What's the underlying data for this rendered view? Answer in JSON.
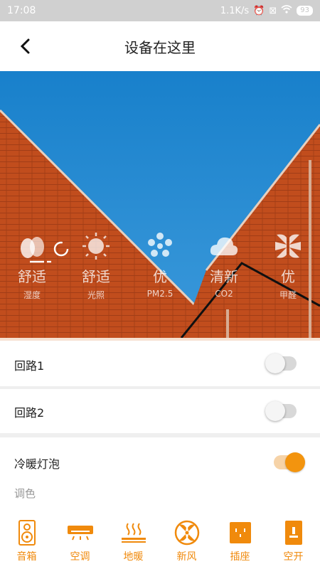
{
  "status_bar": {
    "time": "17:08",
    "speed": "1.1K/s",
    "battery": "93"
  },
  "header": {
    "title": "设备在这里"
  },
  "sensors": [
    {
      "value": "舒适",
      "label": "湿度",
      "icon": "egg-drops-icon"
    },
    {
      "value": "舒适",
      "label": "光照",
      "icon": "sun-icon"
    },
    {
      "value": "优",
      "label": "PM2.5",
      "icon": "particles-icon"
    },
    {
      "value": "清新",
      "label": "CO2",
      "icon": "cloud-icon"
    },
    {
      "value": "优",
      "label": "甲醛",
      "icon": "petals-icon"
    }
  ],
  "switches": [
    {
      "label": "回路1",
      "state": "off"
    },
    {
      "label": "回路2",
      "state": "off"
    },
    {
      "label": "冷暖灯泡",
      "state": "on",
      "sub": "调色"
    }
  ],
  "tabs": [
    {
      "label": "音箱",
      "icon": "speaker-icon"
    },
    {
      "label": "空调",
      "icon": "air-conditioner-icon"
    },
    {
      "label": "地暖",
      "icon": "floor-heating-icon"
    },
    {
      "label": "新风",
      "icon": "fan-icon"
    },
    {
      "label": "插座",
      "icon": "socket-icon"
    },
    {
      "label": "空开",
      "icon": "breaker-icon"
    }
  ],
  "colors": {
    "accent": "#f08a0c",
    "sky": "#1f8ad6",
    "brick": "#c8501e"
  }
}
